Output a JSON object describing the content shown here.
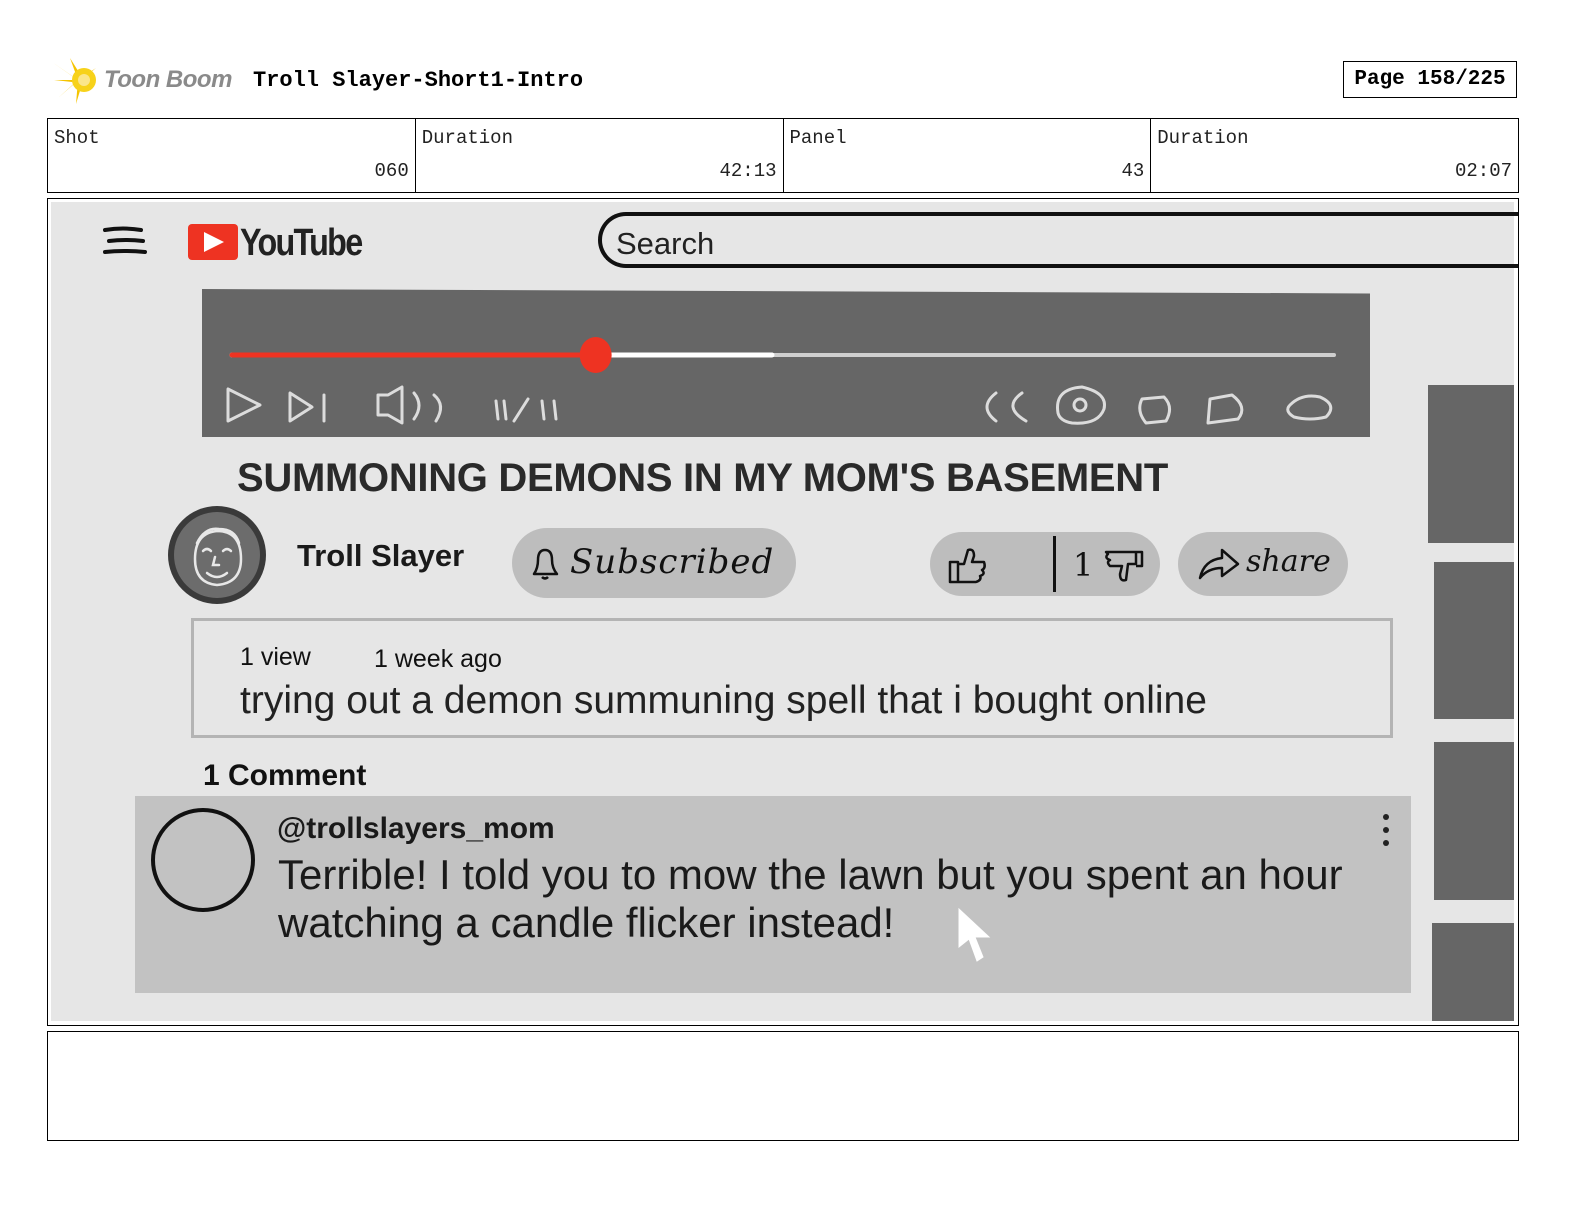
{
  "storyboard": {
    "brand": "Toon Boom",
    "project_title": "Troll Slayer-Short1-Intro",
    "page": "Page 158/225",
    "meta": [
      {
        "label": "Shot",
        "value": "060"
      },
      {
        "label": "Duration",
        "value": "42:13"
      },
      {
        "label": "Panel",
        "value": "43"
      },
      {
        "label": "Duration",
        "value": "02:07"
      }
    ]
  },
  "youtube": {
    "logo_text": "YouTube",
    "search_placeholder": "Search",
    "player": {
      "progress": 0.33,
      "buffered": 0.49,
      "controls": [
        "play-icon",
        "next-icon",
        "volume-icon",
        "time-display",
        "captions-icon",
        "settings-icon",
        "miniplayer-icon",
        "theater-icon",
        "fullscreen-icon"
      ]
    },
    "video_title": "SUMMONING DEMONS IN MY MOM'S BASEMENT",
    "channel_name": "Troll Slayer",
    "subscribe_label": "Subscribed",
    "dislike_count": "1",
    "share_label": "share",
    "views": "1 view",
    "posted": "1 week ago",
    "description": "trying out a demon summuning spell that i bought online",
    "comments_count": "1 Comment",
    "comment": {
      "user": "@trollslayers_mom",
      "text": "Terrible! I told you to mow the lawn but you spent an hour watching a candle flicker instead!"
    }
  },
  "colors": {
    "accent": "#ee3322",
    "screen_bg": "#e6e6e6",
    "player_bg": "#666666",
    "button_bg": "#bdbdbd",
    "comment_bg": "#c2c2c2"
  }
}
